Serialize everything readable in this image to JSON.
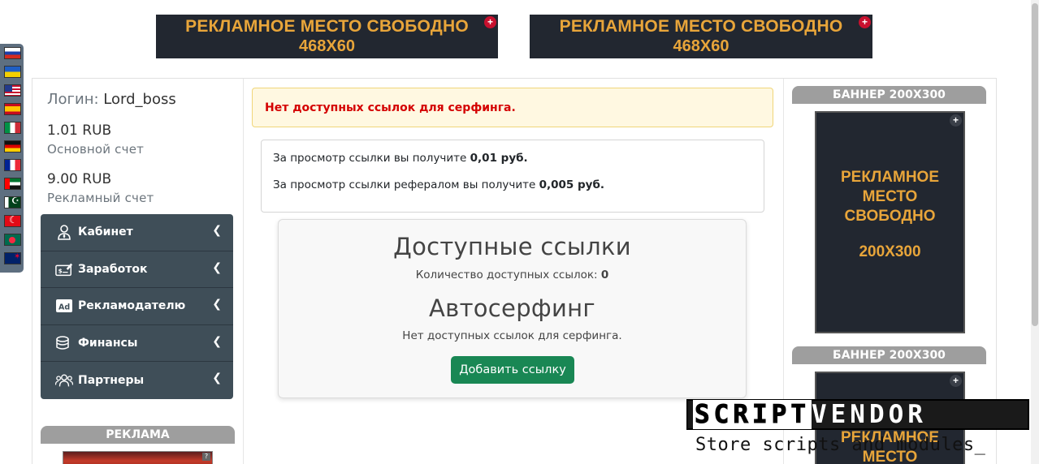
{
  "top_banners": [
    {
      "line1": "РЕКЛАМНОЕ МЕСТО СВОБОДНО",
      "line2": "468X60"
    },
    {
      "line1": "РЕКЛАМНОЕ МЕСТО СВОБОДНО",
      "line2": "468X60"
    }
  ],
  "user": {
    "login_label": "Логин:",
    "login_value": "Lord_boss",
    "main_balance": "1.01 RUB",
    "main_balance_label": "Основной счет",
    "ad_balance": "9.00 RUB",
    "ad_balance_label": "Рекламный счет"
  },
  "menu": [
    {
      "label": "Кабинет",
      "icon": "user-tie-icon"
    },
    {
      "label": "Заработок",
      "icon": "money-check-icon"
    },
    {
      "label": "Рекламодателю",
      "icon": "ad-icon"
    },
    {
      "label": "Финансы",
      "icon": "coins-icon"
    },
    {
      "label": "Партнеры",
      "icon": "users-icon"
    }
  ],
  "reklama": {
    "title": "РЕКЛАМА",
    "thumb_mark": "?"
  },
  "alert": {
    "text": "Нет доступных ссылок для серфинга."
  },
  "info": {
    "line1_text": "За просмотр ссылки вы получите",
    "line1_value": "0,01 руб.",
    "line2_text": "За просмотр ссылки рефералом вы получите",
    "line2_value": "0,005 руб."
  },
  "surf": {
    "title": "Доступные ссылки",
    "count_label": "Количество доступных ссылок:",
    "count_value": "0",
    "autosurf_title": "Автосерфинг",
    "autosurf_text": "Нет доступных ссылок для серфинга.",
    "add_button": "Добавить ссылку"
  },
  "right_banners": [
    {
      "title": "БАННЕР 200X300",
      "lines": [
        "РЕКЛАМНОЕ",
        "МЕСТО",
        "СВОБОДНО",
        "200X300"
      ]
    },
    {
      "title": "БАННЕР 200X300",
      "lines": [
        "РЕКЛАМНОЕ",
        "МЕСТО"
      ]
    }
  ],
  "watermark": {
    "logo_a": "SCRIPT",
    "logo_b": "VENDOR",
    "tagline": "Store scripts and modules_"
  },
  "languages": [
    "ru",
    "ua",
    "us",
    "es",
    "it",
    "de",
    "fr",
    "ae",
    "pk",
    "tr",
    "bd",
    "nz"
  ],
  "colors": {
    "menu_bg": "#3f4e58",
    "ad_bg": "#222730",
    "ad_text": "#e8a53a",
    "alert_text": "#d40000",
    "button_green": "#198754"
  }
}
